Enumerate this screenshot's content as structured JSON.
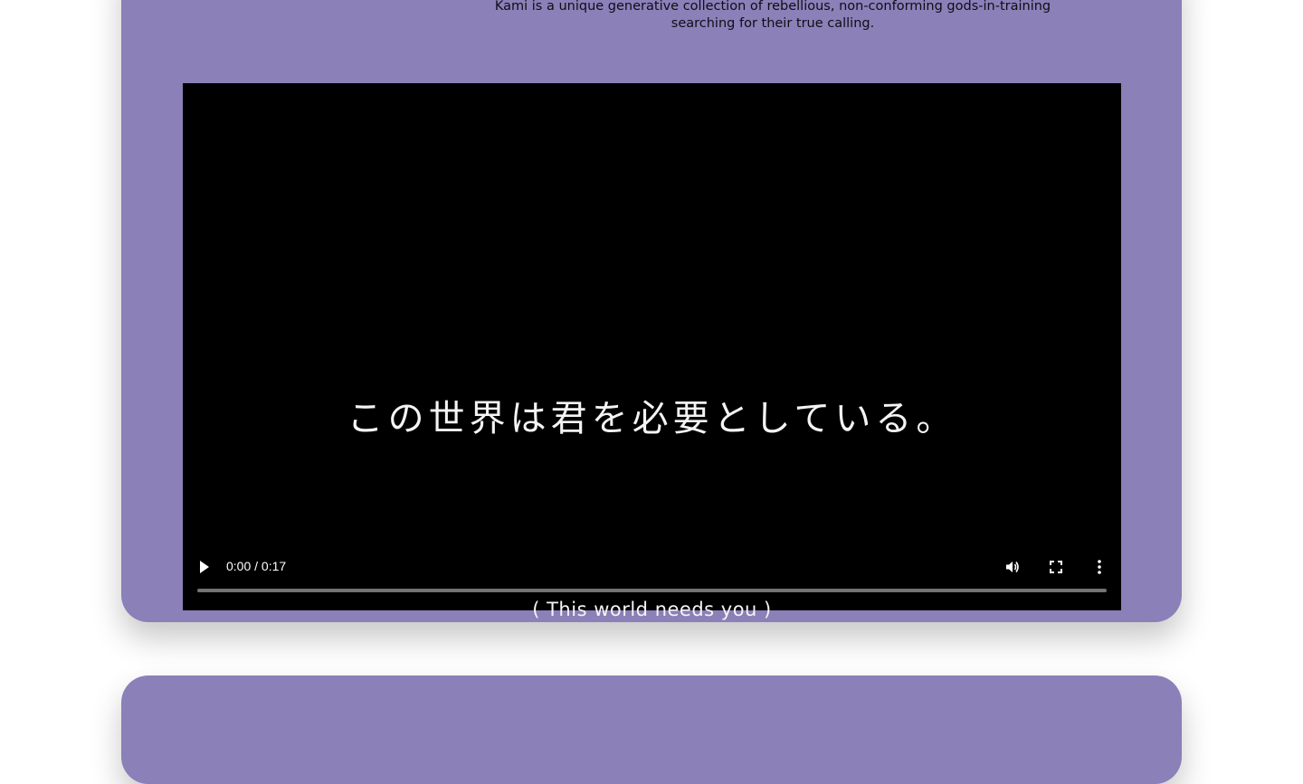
{
  "intro": {
    "line1": "Kami is a unique generative collection of rebellious, non-conforming gods-in-training",
    "line2": "searching for their true calling."
  },
  "video": {
    "caption_jp": "この世界は君を必要としている。",
    "caption_en": "( This world needs you )",
    "time_display": "0:00 / 0:17",
    "progress_fraction": 0.0
  },
  "colors": {
    "card_bg": "#8b80b8",
    "avatar": "#0d9488",
    "video_bg": "#000000"
  },
  "icons": [
    "play-icon",
    "volume-icon",
    "fullscreen-icon",
    "more-options-icon"
  ]
}
